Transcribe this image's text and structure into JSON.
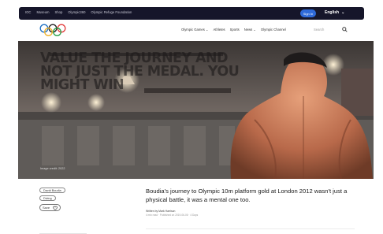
{
  "topbar": {
    "links": [
      "IOC",
      "Museum",
      "Shop",
      "Olympic360",
      "Olympic Refuge Foundation"
    ],
    "signin_label": "Sign In",
    "language": "English"
  },
  "nav": {
    "items": [
      "Olympic Games",
      "Athletes",
      "Sports",
      "News",
      "Olympic Channel"
    ],
    "active": "News",
    "search_placeholder": "Search"
  },
  "hero": {
    "title": "Value the journey and not just the medal. You might win",
    "credit": "Image credit: 2022"
  },
  "article": {
    "tags": [
      "David Boudia",
      "Diving"
    ],
    "save_label": "Save",
    "headline": "Boudia's journey to Olympic 10m platform gold at London 2012 wasn't just a physical battle, it was a mental one too.",
    "byline": "Written by Mark Harrison",
    "meta": "4 min read · Published on 2019-06-06 · 4 Days"
  },
  "colors": {
    "topbar_bg": "#16162a",
    "accent": "#2f6ad9"
  }
}
